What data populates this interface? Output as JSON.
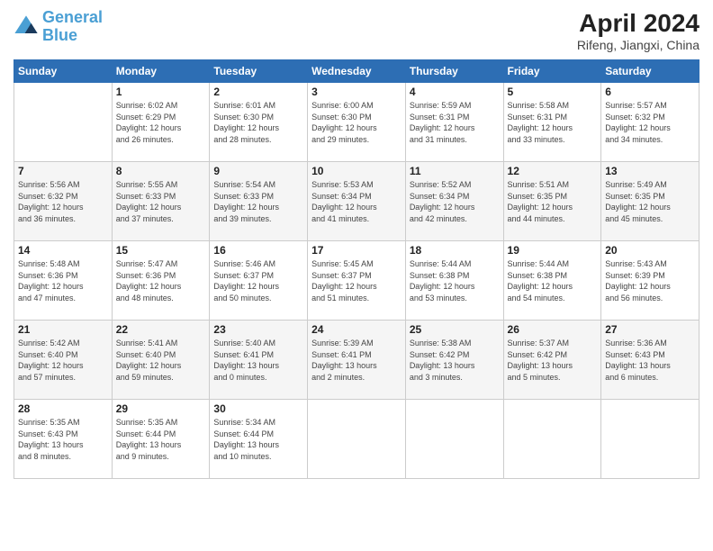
{
  "logo": {
    "line1": "General",
    "line2": "Blue"
  },
  "title": "April 2024",
  "location": "Rifeng, Jiangxi, China",
  "days_of_week": [
    "Sunday",
    "Monday",
    "Tuesday",
    "Wednesday",
    "Thursday",
    "Friday",
    "Saturday"
  ],
  "weeks": [
    [
      {
        "num": "",
        "info": ""
      },
      {
        "num": "1",
        "info": "Sunrise: 6:02 AM\nSunset: 6:29 PM\nDaylight: 12 hours\nand 26 minutes."
      },
      {
        "num": "2",
        "info": "Sunrise: 6:01 AM\nSunset: 6:30 PM\nDaylight: 12 hours\nand 28 minutes."
      },
      {
        "num": "3",
        "info": "Sunrise: 6:00 AM\nSunset: 6:30 PM\nDaylight: 12 hours\nand 29 minutes."
      },
      {
        "num": "4",
        "info": "Sunrise: 5:59 AM\nSunset: 6:31 PM\nDaylight: 12 hours\nand 31 minutes."
      },
      {
        "num": "5",
        "info": "Sunrise: 5:58 AM\nSunset: 6:31 PM\nDaylight: 12 hours\nand 33 minutes."
      },
      {
        "num": "6",
        "info": "Sunrise: 5:57 AM\nSunset: 6:32 PM\nDaylight: 12 hours\nand 34 minutes."
      }
    ],
    [
      {
        "num": "7",
        "info": "Sunrise: 5:56 AM\nSunset: 6:32 PM\nDaylight: 12 hours\nand 36 minutes."
      },
      {
        "num": "8",
        "info": "Sunrise: 5:55 AM\nSunset: 6:33 PM\nDaylight: 12 hours\nand 37 minutes."
      },
      {
        "num": "9",
        "info": "Sunrise: 5:54 AM\nSunset: 6:33 PM\nDaylight: 12 hours\nand 39 minutes."
      },
      {
        "num": "10",
        "info": "Sunrise: 5:53 AM\nSunset: 6:34 PM\nDaylight: 12 hours\nand 41 minutes."
      },
      {
        "num": "11",
        "info": "Sunrise: 5:52 AM\nSunset: 6:34 PM\nDaylight: 12 hours\nand 42 minutes."
      },
      {
        "num": "12",
        "info": "Sunrise: 5:51 AM\nSunset: 6:35 PM\nDaylight: 12 hours\nand 44 minutes."
      },
      {
        "num": "13",
        "info": "Sunrise: 5:49 AM\nSunset: 6:35 PM\nDaylight: 12 hours\nand 45 minutes."
      }
    ],
    [
      {
        "num": "14",
        "info": "Sunrise: 5:48 AM\nSunset: 6:36 PM\nDaylight: 12 hours\nand 47 minutes."
      },
      {
        "num": "15",
        "info": "Sunrise: 5:47 AM\nSunset: 6:36 PM\nDaylight: 12 hours\nand 48 minutes."
      },
      {
        "num": "16",
        "info": "Sunrise: 5:46 AM\nSunset: 6:37 PM\nDaylight: 12 hours\nand 50 minutes."
      },
      {
        "num": "17",
        "info": "Sunrise: 5:45 AM\nSunset: 6:37 PM\nDaylight: 12 hours\nand 51 minutes."
      },
      {
        "num": "18",
        "info": "Sunrise: 5:44 AM\nSunset: 6:38 PM\nDaylight: 12 hours\nand 53 minutes."
      },
      {
        "num": "19",
        "info": "Sunrise: 5:44 AM\nSunset: 6:38 PM\nDaylight: 12 hours\nand 54 minutes."
      },
      {
        "num": "20",
        "info": "Sunrise: 5:43 AM\nSunset: 6:39 PM\nDaylight: 12 hours\nand 56 minutes."
      }
    ],
    [
      {
        "num": "21",
        "info": "Sunrise: 5:42 AM\nSunset: 6:40 PM\nDaylight: 12 hours\nand 57 minutes."
      },
      {
        "num": "22",
        "info": "Sunrise: 5:41 AM\nSunset: 6:40 PM\nDaylight: 12 hours\nand 59 minutes."
      },
      {
        "num": "23",
        "info": "Sunrise: 5:40 AM\nSunset: 6:41 PM\nDaylight: 13 hours\nand 0 minutes."
      },
      {
        "num": "24",
        "info": "Sunrise: 5:39 AM\nSunset: 6:41 PM\nDaylight: 13 hours\nand 2 minutes."
      },
      {
        "num": "25",
        "info": "Sunrise: 5:38 AM\nSunset: 6:42 PM\nDaylight: 13 hours\nand 3 minutes."
      },
      {
        "num": "26",
        "info": "Sunrise: 5:37 AM\nSunset: 6:42 PM\nDaylight: 13 hours\nand 5 minutes."
      },
      {
        "num": "27",
        "info": "Sunrise: 5:36 AM\nSunset: 6:43 PM\nDaylight: 13 hours\nand 6 minutes."
      }
    ],
    [
      {
        "num": "28",
        "info": "Sunrise: 5:35 AM\nSunset: 6:43 PM\nDaylight: 13 hours\nand 8 minutes."
      },
      {
        "num": "29",
        "info": "Sunrise: 5:35 AM\nSunset: 6:44 PM\nDaylight: 13 hours\nand 9 minutes."
      },
      {
        "num": "30",
        "info": "Sunrise: 5:34 AM\nSunset: 6:44 PM\nDaylight: 13 hours\nand 10 minutes."
      },
      {
        "num": "",
        "info": ""
      },
      {
        "num": "",
        "info": ""
      },
      {
        "num": "",
        "info": ""
      },
      {
        "num": "",
        "info": ""
      }
    ]
  ]
}
